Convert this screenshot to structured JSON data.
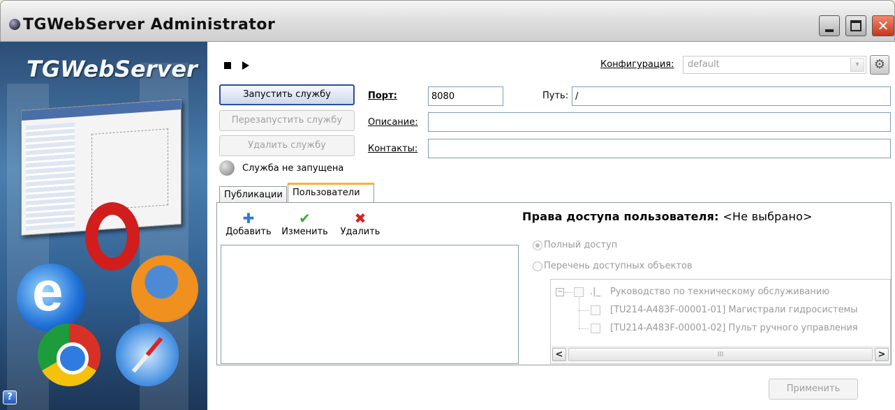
{
  "window": {
    "title": "TGWebServer Administrator",
    "icon": "globe-icon",
    "min_glyph": "_",
    "max_glyph": "□",
    "close_glyph": "✕"
  },
  "banner": {
    "brand": "TGWebServer",
    "help_glyph": "?"
  },
  "toolbar": {
    "stop_icon": "stop-icon",
    "play_icon": "play-icon",
    "config_label": "Конфигурация:",
    "config_value": "default",
    "config_arrow": "▾",
    "gear_icon": "⚙"
  },
  "service": {
    "start_label": "Запустить службу",
    "restart_label": "Перезапустить службу",
    "delete_label": "Удалить службу",
    "status_text": "Служба не запущена"
  },
  "fields": {
    "port_label": "Порт:",
    "port_value": "8080",
    "path_label": "Путь:",
    "path_value": "/",
    "description_label": "Описание:",
    "description_value": "",
    "contacts_label": "Контакты:",
    "contacts_value": ""
  },
  "tabs": [
    {
      "label": "Публикации",
      "active": false
    },
    {
      "label": "Пользователи",
      "active": true
    }
  ],
  "users": {
    "add_label": "Добавить",
    "edit_label": "Изменить",
    "delete_label": "Удалить",
    "add_icon": "✚",
    "edit_icon": "✔",
    "delete_icon": "✖",
    "items": []
  },
  "rights": {
    "title": "Права доступа пользователя:",
    "selected": "<Не выбрано>",
    "full_access": "Полный доступ",
    "object_list": "Перечень доступных объектов",
    "tree": {
      "root": "Руководство по техническому обслуживанию",
      "children": [
        "[TU214-A483F-00001-01] Магистрали гидросистемы",
        "[TU214-A483F-00001-02] Пульт ручного управления"
      ]
    },
    "scroll_left": "<",
    "scroll_right": ">",
    "scroll_thumb": "III"
  },
  "apply_label": "Применить"
}
